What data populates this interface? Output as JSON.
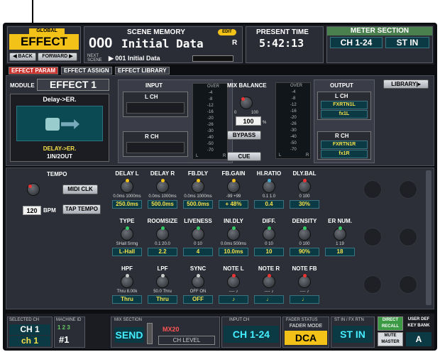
{
  "header": {
    "global_label": "GLOBAL",
    "global_value": "EFFECT",
    "back_label": "◀ BACK",
    "forward_label": "FORWARD ▶",
    "scene_title": "SCENE MEMORY",
    "edit_badge": "EDIT",
    "scene_number": "000",
    "scene_name": "Initial Data",
    "scene_r": "R",
    "next_label": "NEXT SCENE",
    "next_scene": "▶ 001 Initial Data",
    "time_title": "PRESENT TIME",
    "time_value": "5:42:13",
    "meter_title": "METER SECTION",
    "meter_ch": "CH 1-24",
    "meter_st": "ST IN"
  },
  "tabs": [
    "EFFECT PARAM",
    "EFFECT ASSIGN",
    "EFFECT LIBRARY"
  ],
  "module": {
    "label": "MODULE",
    "value": "EFFECT 1",
    "type_title": "Delay->ER.",
    "type_name": "DELAY->ER.",
    "io": "1IN/2OUT"
  },
  "input": {
    "title": "INPUT",
    "l": "L CH",
    "r": "R CH"
  },
  "meter_scale": [
    "OVER",
    "-4",
    "-8",
    "-12",
    "-16",
    "-20",
    "-26",
    "-30",
    "-40",
    "-50",
    "-70",
    "L",
    "R"
  ],
  "mix": {
    "title": "MIX BALANCE",
    "min": "0",
    "max": "100",
    "value": "100",
    "unit": "%",
    "bypass": "BYPASS",
    "cue": "CUE"
  },
  "output": {
    "title": "OUTPUT",
    "l": "L CH",
    "l_port": "FXRTN1L",
    "l_name": "fx1L",
    "r": "R CH",
    "r_port": "FXRTN1R",
    "r_name": "fx1R"
  },
  "library_btn": "LIBRARY|▸",
  "tempo": {
    "label": "TEMPO",
    "midi": "MIDI CLK",
    "value": "120",
    "unit": "BPM",
    "tap": "TAP TEMPO"
  },
  "params": [
    [
      {
        "n": "DELAY L",
        "r": "0.0ms 1000ms",
        "v": "250.0ms"
      },
      {
        "n": "DELAY R",
        "r": "0.0ms 1000ms",
        "v": "500.0ms"
      },
      {
        "n": "FB.DLY",
        "r": "0.0ms 1000ms",
        "v": "500.0ms"
      },
      {
        "n": "FB.GAIN",
        "r": "-99 +99",
        "v": "+ 48%"
      },
      {
        "n": "HI.RATIO",
        "r": "0.1 1.0",
        "v": "0.4"
      },
      {
        "n": "DLY.BAL",
        "r": "0 100",
        "v": "30%"
      }
    ],
    [
      {
        "n": "TYPE",
        "r": "SHall Srrng",
        "v": "L-Hall"
      },
      {
        "n": "ROOMSIZE",
        "r": "0.1 20.0",
        "v": "2.2"
      },
      {
        "n": "LIVENESS",
        "r": "0 10",
        "v": "4"
      },
      {
        "n": "INI.DLY",
        "r": "0.0ms 500ms",
        "v": "10.0ms"
      },
      {
        "n": "DIFF.",
        "r": "0 10",
        "v": "10"
      },
      {
        "n": "DENSITY",
        "r": "0 100",
        "v": "90%"
      },
      {
        "n": "ER NUM.",
        "r": "1 19",
        "v": "18"
      }
    ],
    [
      {
        "n": "HPF",
        "r": "Thru 8.00k",
        "v": "Thru"
      },
      {
        "n": "LPF",
        "r": "50.0 Thru",
        "v": "Thru"
      },
      {
        "n": "SYNC",
        "r": "OFF ON",
        "v": "OFF"
      },
      {
        "n": "NOTE L",
        "r": "---- ♪",
        "v": "♪"
      },
      {
        "n": "NOTE R",
        "r": "---- ♪",
        "v": "♩"
      },
      {
        "n": "NOTE FB",
        "r": "---- ♪",
        "v": "♩"
      }
    ]
  ],
  "footer": {
    "sel_title": "SELECTED CH",
    "sel_ch": "CH 1",
    "sel_name": "ch 1",
    "machine_title": "MACHINE ID",
    "machine_nums": "1 2 3",
    "machine_id": "#1",
    "mix_title": "MIX SECTION",
    "mix_value": "SEND",
    "mx_label": "MX20",
    "ch_level": "CH LEVEL",
    "input_title": "INPUT CH",
    "input_value": "CH 1-24",
    "fader_title": "FADER STATUS",
    "fader_mode": "FADER MODE",
    "fader_value": "DCA",
    "stin_title": "ST IN / FX RTN",
    "stin_value": "ST IN",
    "direct": "DIRECT RECALL",
    "user_def": "USER DEF KEY BANK",
    "mute": "MUTE MASTER",
    "bank": "A"
  }
}
